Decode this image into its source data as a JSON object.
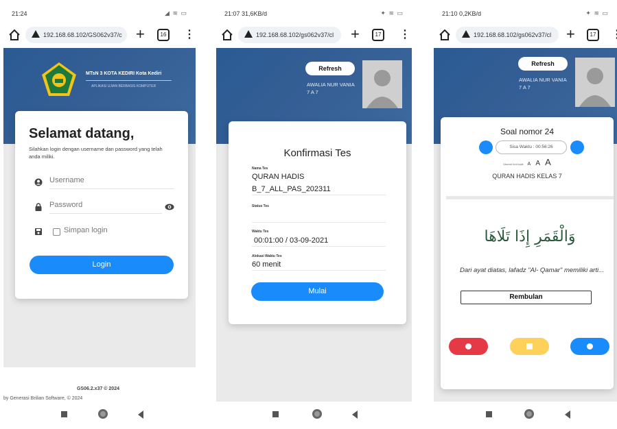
{
  "colors": {
    "header": "#2f5e95",
    "accent": "#1a8bfa",
    "red": "#e53945",
    "yellow": "#fed15a",
    "logo_green": "#1e7a3a"
  },
  "phone1": {
    "status_time": "21:24",
    "url": "192.168.68.102/GS062v37/c",
    "tab_count": "16",
    "school_name": "MTsN 3 KOTA KEDIRI Kota Kediri",
    "school_sub": "APLIKASI UJIAN BERBASIS KOMPUTER",
    "welcome": "Selamat datang,",
    "intro": "Silahkan login dengan username dan password yang telah anda miliki.",
    "username_placeholder": "Username",
    "password_placeholder": "Password",
    "remember_label": "Simpan login",
    "login_button": "Login",
    "footer_version": "GS06.2.x37 © 2024",
    "footer_credit": "by Generasi Brilian Software, © 2024"
  },
  "phone2": {
    "status_time": "21:07 31,6KB/d",
    "url": "192.168.68.102/gs062v37/cl",
    "tab_count": "17",
    "refresh": "Refresh",
    "user_name": "AWALIA NUR VANIA",
    "user_class": "7 A 7",
    "title": "Konfirmasi Tes",
    "nama_label": "Nama Tes",
    "nama_line1": "QURAN HADIS",
    "nama_line2": "B_7_ALL_PAS_202311",
    "status_label": "Status Tes",
    "waktu_label": "Waktu Tes",
    "waktu_value": "00:01:00 / 03-09-2021",
    "alokasi_label": "Alokasi Waktu Tes",
    "alokasi_value": "60 menit",
    "start_button": "Mulai"
  },
  "phone3": {
    "status_time": "21:10 0,2KB/d",
    "url": "192.168.68.102/gs062v37/cl",
    "tab_count": "17",
    "refresh": "Refresh",
    "user_name": "AWALIA NUR VANIA",
    "user_class": "7 A 7",
    "question_number": "Soal nomor 24",
    "remaining_time": "Sisa Waktu : 00:56:26",
    "font_size_label": "Ukuran font soal:",
    "font_a": "A",
    "subject": "QURAN HADIS KELAS 7",
    "arabic": "وَالْقَمَرِ إِذَا تَلَاهَا",
    "question_text": "Dari ayat diatas, lafadz \"Al- Qamar\" memiliki arti...",
    "answer": "Rembulan"
  }
}
